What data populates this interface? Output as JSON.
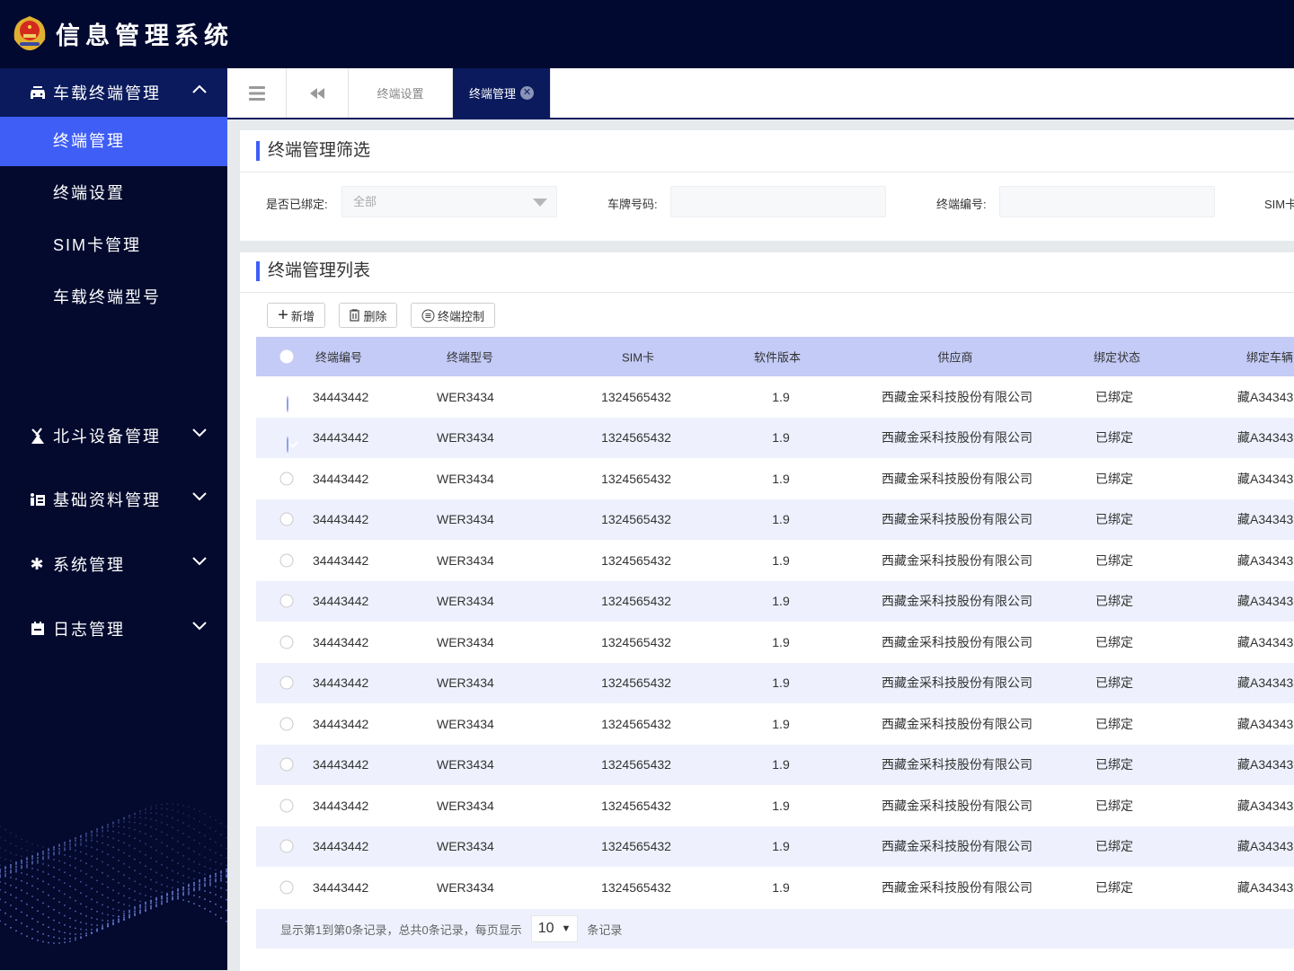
{
  "app": {
    "title": "信息管理系统",
    "emblem": "police-emblem"
  },
  "sidebar": {
    "open_group": {
      "label": "车载终端管理",
      "icon": "car-icon"
    },
    "items": [
      {
        "label": "终端管理",
        "active": true
      },
      {
        "label": "终端设置"
      },
      {
        "label": "SIM卡管理"
      },
      {
        "label": "车载终端型号"
      }
    ],
    "groups": [
      {
        "label": "北斗设备管理",
        "icon": "satellite-icon"
      },
      {
        "label": "基础资料管理",
        "icon": "info-icon"
      },
      {
        "label": "系统管理",
        "icon": "gear-icon"
      },
      {
        "label": "日志管理",
        "icon": "calendar-icon"
      }
    ]
  },
  "tabs": [
    {
      "label": "终端设置"
    },
    {
      "label": "终端管理",
      "active": true
    }
  ],
  "filter": {
    "title": "终端管理筛选",
    "bound_label": "是否已绑定:",
    "bound_value": "全部",
    "plate_label": "车牌号码:",
    "plate_value": "",
    "terminal_label": "终端编号:",
    "terminal_value": "",
    "sim_label": "SIM卡"
  },
  "list": {
    "title": "终端管理列表",
    "buttons": {
      "add": "新增",
      "delete": "删除",
      "control": "终端控制"
    },
    "columns": [
      "终端编号",
      "终端型号",
      "SIM卡",
      "软件版本",
      "供应商",
      "绑定状态",
      "绑定车辆"
    ],
    "rows": [
      {
        "checked": true,
        "id": "34443442",
        "model": "WER3434",
        "sim": "1324565432",
        "ver": "1.9",
        "supplier": "西藏金采科技股份有限公司",
        "status": "已绑定",
        "vehicle": "藏A34343"
      },
      {
        "checked": true,
        "id": "34443442",
        "model": "WER3434",
        "sim": "1324565432",
        "ver": "1.9",
        "supplier": "西藏金采科技股份有限公司",
        "status": "已绑定",
        "vehicle": "藏A34343"
      },
      {
        "checked": false,
        "id": "34443442",
        "model": "WER3434",
        "sim": "1324565432",
        "ver": "1.9",
        "supplier": "西藏金采科技股份有限公司",
        "status": "已绑定",
        "vehicle": "藏A34343"
      },
      {
        "checked": false,
        "id": "34443442",
        "model": "WER3434",
        "sim": "1324565432",
        "ver": "1.9",
        "supplier": "西藏金采科技股份有限公司",
        "status": "已绑定",
        "vehicle": "藏A34343"
      },
      {
        "checked": false,
        "id": "34443442",
        "model": "WER3434",
        "sim": "1324565432",
        "ver": "1.9",
        "supplier": "西藏金采科技股份有限公司",
        "status": "已绑定",
        "vehicle": "藏A34343"
      },
      {
        "checked": false,
        "id": "34443442",
        "model": "WER3434",
        "sim": "1324565432",
        "ver": "1.9",
        "supplier": "西藏金采科技股份有限公司",
        "status": "已绑定",
        "vehicle": "藏A34343"
      },
      {
        "checked": false,
        "id": "34443442",
        "model": "WER3434",
        "sim": "1324565432",
        "ver": "1.9",
        "supplier": "西藏金采科技股份有限公司",
        "status": "已绑定",
        "vehicle": "藏A34343"
      },
      {
        "checked": false,
        "id": "34443442",
        "model": "WER3434",
        "sim": "1324565432",
        "ver": "1.9",
        "supplier": "西藏金采科技股份有限公司",
        "status": "已绑定",
        "vehicle": "藏A34343"
      },
      {
        "checked": false,
        "id": "34443442",
        "model": "WER3434",
        "sim": "1324565432",
        "ver": "1.9",
        "supplier": "西藏金采科技股份有限公司",
        "status": "已绑定",
        "vehicle": "藏A34343"
      },
      {
        "checked": false,
        "id": "34443442",
        "model": "WER3434",
        "sim": "1324565432",
        "ver": "1.9",
        "supplier": "西藏金采科技股份有限公司",
        "status": "已绑定",
        "vehicle": "藏A34343"
      },
      {
        "checked": false,
        "id": "34443442",
        "model": "WER3434",
        "sim": "1324565432",
        "ver": "1.9",
        "supplier": "西藏金采科技股份有限公司",
        "status": "已绑定",
        "vehicle": "藏A34343"
      },
      {
        "checked": false,
        "id": "34443442",
        "model": "WER3434",
        "sim": "1324565432",
        "ver": "1.9",
        "supplier": "西藏金采科技股份有限公司",
        "status": "已绑定",
        "vehicle": "藏A34343"
      },
      {
        "checked": false,
        "id": "34443442",
        "model": "WER3434",
        "sim": "1324565432",
        "ver": "1.9",
        "supplier": "西藏金采科技股份有限公司",
        "status": "已绑定",
        "vehicle": "藏A34343"
      }
    ],
    "pager": {
      "text": "显示第1到第0条记录，总共0条记录，每页显示",
      "page_size": "10",
      "suffix": "条记录"
    }
  },
  "colors": {
    "topbar": "#020930",
    "sidebar": "#030a2e",
    "accent": "#3f5ef6",
    "table_header": "#c3cbf6",
    "row_alt": "#eef1fd"
  }
}
